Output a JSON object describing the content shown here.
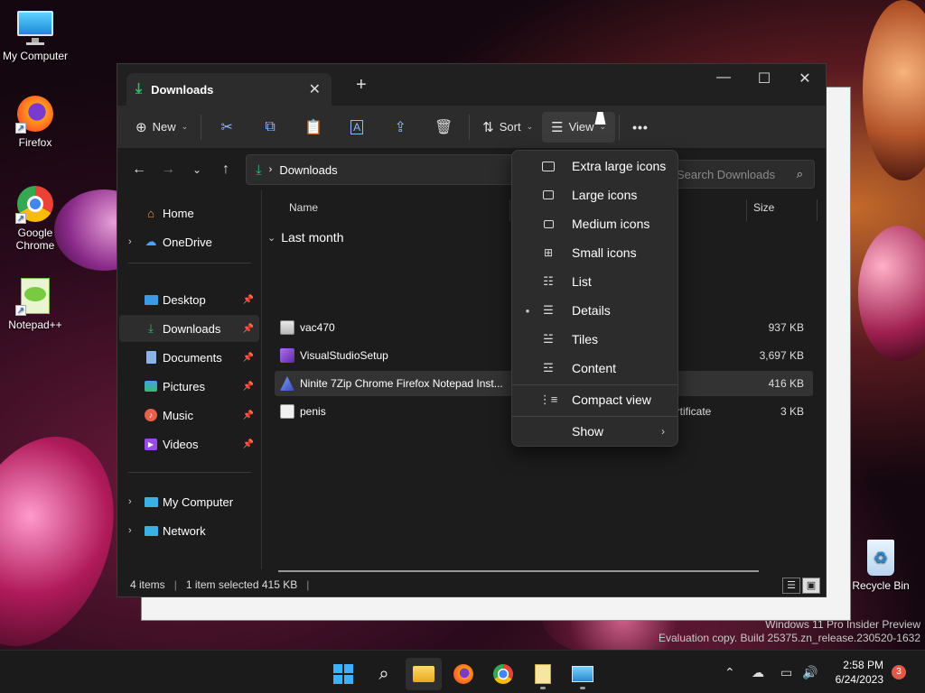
{
  "desktop": {
    "icons": [
      {
        "label": "My Computer"
      },
      {
        "label": "Firefox"
      },
      {
        "label": "Google Chrome"
      },
      {
        "label": "Notepad++"
      }
    ],
    "recycle_bin": "Recycle Bin",
    "watermark": {
      "line1": "Windows 11 Pro Insider Preview",
      "line2": "Evaluation copy. Build 25375.zn_release.230520-1632"
    }
  },
  "window": {
    "tab_title": "Downloads",
    "toolbar": {
      "new_label": "New",
      "sort_label": "Sort",
      "view_label": "View",
      "more_label": "•••"
    },
    "address": {
      "crumb": "Downloads",
      "search_placeholder": "Search Downloads"
    },
    "sidebar": {
      "home": "Home",
      "onedrive": "OneDrive",
      "pinned": [
        {
          "label": "Desktop"
        },
        {
          "label": "Downloads"
        },
        {
          "label": "Documents"
        },
        {
          "label": "Pictures"
        },
        {
          "label": "Music"
        },
        {
          "label": "Videos"
        }
      ],
      "my_computer": "My Computer",
      "network": "Network"
    },
    "columns": {
      "name": "Name",
      "size": "Size"
    },
    "group_label": "Last month",
    "files": [
      {
        "name": "vac470",
        "type": "tion",
        "size": "937 KB"
      },
      {
        "name": "VisualStudioSetup",
        "type": "tion",
        "size": "3,697 KB"
      },
      {
        "name": "Ninite 7Zip Chrome Firefox Notepad Inst...",
        "type": "tion",
        "size": "416 KB"
      },
      {
        "name": "penis",
        "type": "y Certificate",
        "size": "3 KB"
      }
    ],
    "status": {
      "items": "4 items",
      "selected": "1 item selected  415 KB"
    }
  },
  "view_menu": {
    "items": [
      {
        "label": "Extra large icons"
      },
      {
        "label": "Large icons"
      },
      {
        "label": "Medium icons"
      },
      {
        "label": "Small icons"
      },
      {
        "label": "List"
      },
      {
        "label": "Details"
      },
      {
        "label": "Tiles"
      },
      {
        "label": "Content"
      }
    ],
    "compact": "Compact view",
    "show": "Show"
  },
  "taskbar": {
    "time": "2:58 PM",
    "date": "6/24/2023",
    "notification_count": "3"
  },
  "colors": {
    "accent": "#5fb2ff",
    "download_green": "#2fbf71",
    "folder_yellow": "#f4c542"
  }
}
